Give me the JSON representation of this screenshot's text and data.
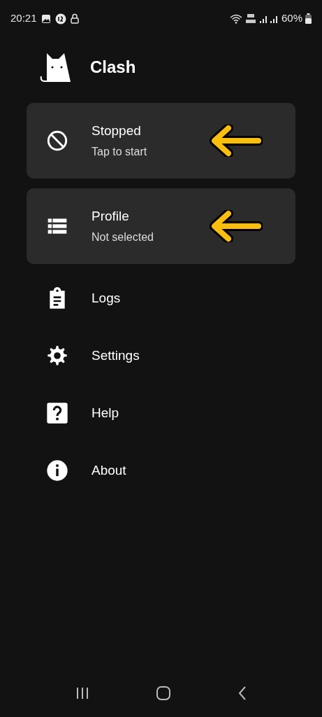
{
  "status_bar": {
    "time": "20:21",
    "battery": "60%"
  },
  "app": {
    "title": "Clash"
  },
  "cards": [
    {
      "title": "Stopped",
      "subtitle": "Tap to start"
    },
    {
      "title": "Profile",
      "subtitle": "Not selected"
    }
  ],
  "menu": [
    {
      "label": "Logs"
    },
    {
      "label": "Settings"
    },
    {
      "label": "Help"
    },
    {
      "label": "About"
    }
  ]
}
